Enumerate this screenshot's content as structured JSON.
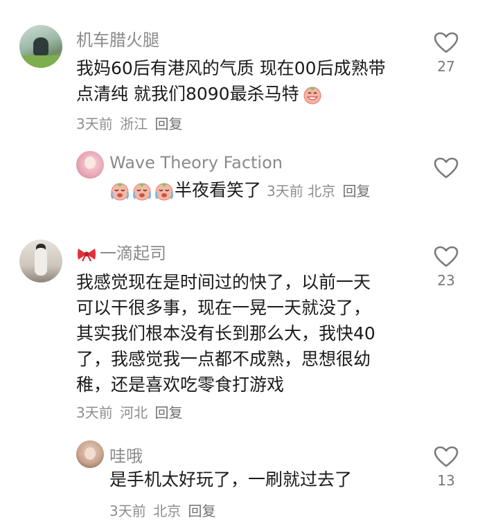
{
  "comments": [
    {
      "author": "机车腊火腿",
      "lines": [
        "我妈60后有港风的气质  现在00后成熟带",
        "点清纯 就我们8090最杀马特"
      ],
      "time": "3天前",
      "location": "浙江",
      "reply_label": "回复",
      "likes": "27",
      "replies": [
        {
          "author": "Wave Theory Faction",
          "text": "半夜看笑了",
          "time": "3天前",
          "location": "北京",
          "reply_label": "回复"
        }
      ]
    },
    {
      "author": "一滴起司",
      "lines": [
        "我感觉现在是时间过的快了，以前一天",
        "可以干很多事，现在一晃一天就没了，",
        "其实我们根本没有长到那么大，我快40",
        "了，我感觉我一点都不成熟，思想很幼",
        "稚，还是喜欢吃零食打游戏"
      ],
      "time": "3天前",
      "location": "河北",
      "reply_label": "回复",
      "likes": "23",
      "replies": [
        {
          "author": "哇哦",
          "text": "是手机太好玩了，一刷就过去了",
          "time": "3天前",
          "location": "北京",
          "reply_label": "回复",
          "likes": "13"
        }
      ]
    }
  ],
  "icons": {
    "like": "heart-outline-icon",
    "emoji_grin": "grin-face-emoji",
    "emoji_cry_laugh": "crying-laughing-emoji",
    "bow": "ribbon-bow-icon"
  },
  "colors": {
    "text": "#1a1a1a",
    "meta": "#8d8d8d",
    "name": "#8a8a8a",
    "icon": "#7a7a7a"
  }
}
